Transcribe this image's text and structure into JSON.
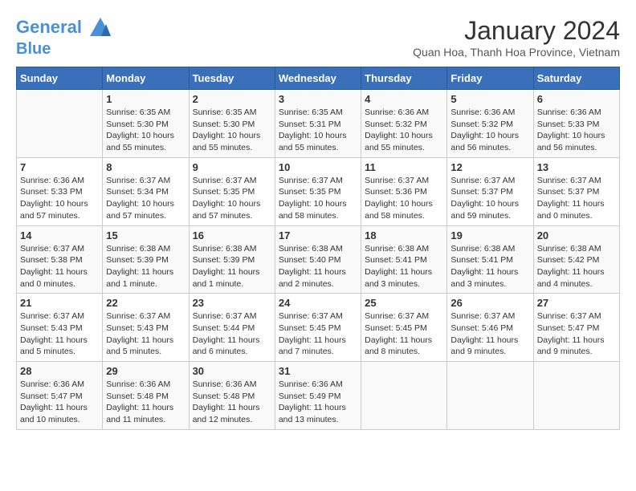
{
  "header": {
    "logo_line1": "General",
    "logo_line2": "Blue",
    "month": "January 2024",
    "location": "Quan Hoa, Thanh Hoa Province, Vietnam"
  },
  "weekdays": [
    "Sunday",
    "Monday",
    "Tuesday",
    "Wednesday",
    "Thursday",
    "Friday",
    "Saturday"
  ],
  "weeks": [
    [
      {
        "day": "",
        "info": ""
      },
      {
        "day": "1",
        "info": "Sunrise: 6:35 AM\nSunset: 5:30 PM\nDaylight: 10 hours\nand 55 minutes."
      },
      {
        "day": "2",
        "info": "Sunrise: 6:35 AM\nSunset: 5:30 PM\nDaylight: 10 hours\nand 55 minutes."
      },
      {
        "day": "3",
        "info": "Sunrise: 6:35 AM\nSunset: 5:31 PM\nDaylight: 10 hours\nand 55 minutes."
      },
      {
        "day": "4",
        "info": "Sunrise: 6:36 AM\nSunset: 5:32 PM\nDaylight: 10 hours\nand 55 minutes."
      },
      {
        "day": "5",
        "info": "Sunrise: 6:36 AM\nSunset: 5:32 PM\nDaylight: 10 hours\nand 56 minutes."
      },
      {
        "day": "6",
        "info": "Sunrise: 6:36 AM\nSunset: 5:33 PM\nDaylight: 10 hours\nand 56 minutes."
      }
    ],
    [
      {
        "day": "7",
        "info": "Sunrise: 6:36 AM\nSunset: 5:33 PM\nDaylight: 10 hours\nand 57 minutes."
      },
      {
        "day": "8",
        "info": "Sunrise: 6:37 AM\nSunset: 5:34 PM\nDaylight: 10 hours\nand 57 minutes."
      },
      {
        "day": "9",
        "info": "Sunrise: 6:37 AM\nSunset: 5:35 PM\nDaylight: 10 hours\nand 57 minutes."
      },
      {
        "day": "10",
        "info": "Sunrise: 6:37 AM\nSunset: 5:35 PM\nDaylight: 10 hours\nand 58 minutes."
      },
      {
        "day": "11",
        "info": "Sunrise: 6:37 AM\nSunset: 5:36 PM\nDaylight: 10 hours\nand 58 minutes."
      },
      {
        "day": "12",
        "info": "Sunrise: 6:37 AM\nSunset: 5:37 PM\nDaylight: 10 hours\nand 59 minutes."
      },
      {
        "day": "13",
        "info": "Sunrise: 6:37 AM\nSunset: 5:37 PM\nDaylight: 11 hours\nand 0 minutes."
      }
    ],
    [
      {
        "day": "14",
        "info": "Sunrise: 6:37 AM\nSunset: 5:38 PM\nDaylight: 11 hours\nand 0 minutes."
      },
      {
        "day": "15",
        "info": "Sunrise: 6:38 AM\nSunset: 5:39 PM\nDaylight: 11 hours\nand 1 minute."
      },
      {
        "day": "16",
        "info": "Sunrise: 6:38 AM\nSunset: 5:39 PM\nDaylight: 11 hours\nand 1 minute."
      },
      {
        "day": "17",
        "info": "Sunrise: 6:38 AM\nSunset: 5:40 PM\nDaylight: 11 hours\nand 2 minutes."
      },
      {
        "day": "18",
        "info": "Sunrise: 6:38 AM\nSunset: 5:41 PM\nDaylight: 11 hours\nand 3 minutes."
      },
      {
        "day": "19",
        "info": "Sunrise: 6:38 AM\nSunset: 5:41 PM\nDaylight: 11 hours\nand 3 minutes."
      },
      {
        "day": "20",
        "info": "Sunrise: 6:38 AM\nSunset: 5:42 PM\nDaylight: 11 hours\nand 4 minutes."
      }
    ],
    [
      {
        "day": "21",
        "info": "Sunrise: 6:37 AM\nSunset: 5:43 PM\nDaylight: 11 hours\nand 5 minutes."
      },
      {
        "day": "22",
        "info": "Sunrise: 6:37 AM\nSunset: 5:43 PM\nDaylight: 11 hours\nand 5 minutes."
      },
      {
        "day": "23",
        "info": "Sunrise: 6:37 AM\nSunset: 5:44 PM\nDaylight: 11 hours\nand 6 minutes."
      },
      {
        "day": "24",
        "info": "Sunrise: 6:37 AM\nSunset: 5:45 PM\nDaylight: 11 hours\nand 7 minutes."
      },
      {
        "day": "25",
        "info": "Sunrise: 6:37 AM\nSunset: 5:45 PM\nDaylight: 11 hours\nand 8 minutes."
      },
      {
        "day": "26",
        "info": "Sunrise: 6:37 AM\nSunset: 5:46 PM\nDaylight: 11 hours\nand 9 minutes."
      },
      {
        "day": "27",
        "info": "Sunrise: 6:37 AM\nSunset: 5:47 PM\nDaylight: 11 hours\nand 9 minutes."
      }
    ],
    [
      {
        "day": "28",
        "info": "Sunrise: 6:36 AM\nSunset: 5:47 PM\nDaylight: 11 hours\nand 10 minutes."
      },
      {
        "day": "29",
        "info": "Sunrise: 6:36 AM\nSunset: 5:48 PM\nDaylight: 11 hours\nand 11 minutes."
      },
      {
        "day": "30",
        "info": "Sunrise: 6:36 AM\nSunset: 5:48 PM\nDaylight: 11 hours\nand 12 minutes."
      },
      {
        "day": "31",
        "info": "Sunrise: 6:36 AM\nSunset: 5:49 PM\nDaylight: 11 hours\nand 13 minutes."
      },
      {
        "day": "",
        "info": ""
      },
      {
        "day": "",
        "info": ""
      },
      {
        "day": "",
        "info": ""
      }
    ]
  ]
}
